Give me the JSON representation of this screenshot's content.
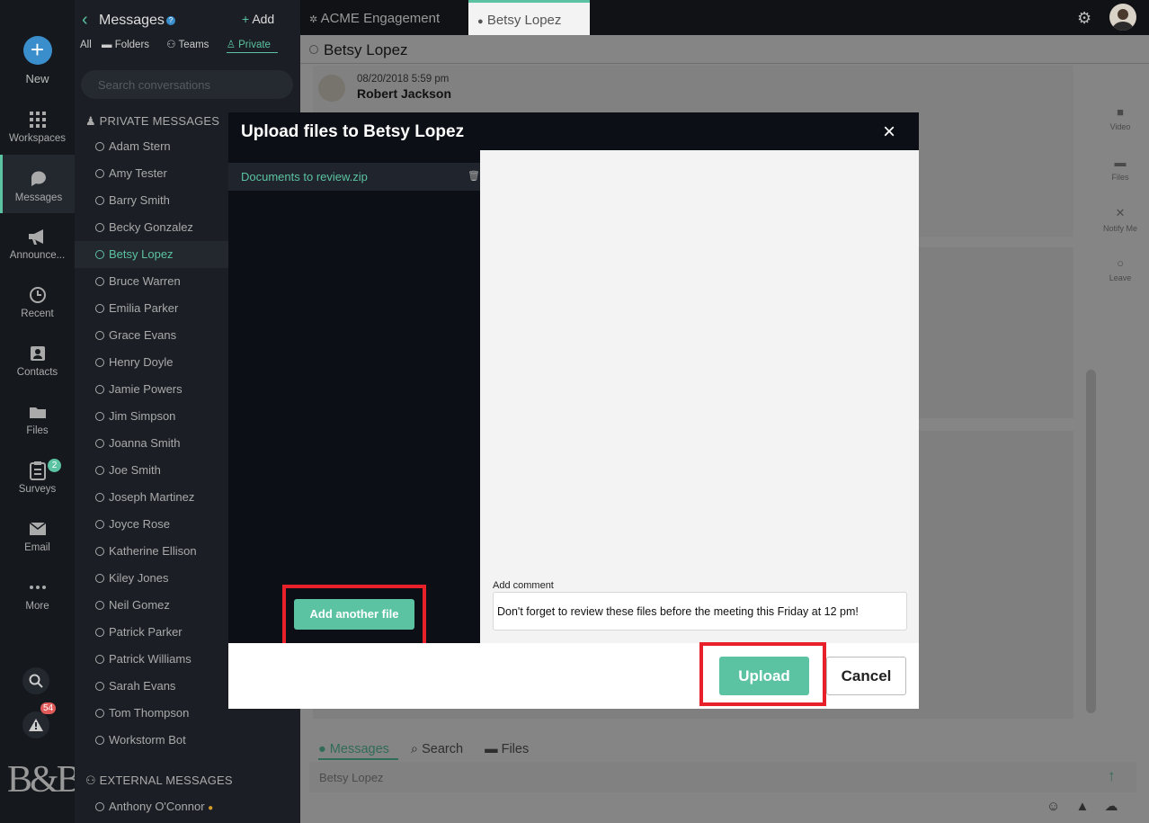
{
  "rail": {
    "new_label": "New",
    "items": [
      {
        "label": "Workspaces",
        "icon": "grid-icon"
      },
      {
        "label": "Messages",
        "icon": "chat-icon"
      },
      {
        "label": "Announce...",
        "icon": "megaphone-icon"
      },
      {
        "label": "Recent",
        "icon": "history-icon"
      },
      {
        "label": "Contacts",
        "icon": "contacts-icon"
      },
      {
        "label": "Files",
        "icon": "folder-icon"
      },
      {
        "label": "Surveys",
        "icon": "survey-icon",
        "badge": "2"
      },
      {
        "label": "Email",
        "icon": "envelope-icon"
      },
      {
        "label": "More",
        "icon": "ellipsis-icon"
      }
    ],
    "alert_badge": "54",
    "logo": "B&B"
  },
  "sidebar": {
    "title": "Messages",
    "help": "?",
    "add_label": "Add",
    "filters": [
      "All",
      "Folders",
      "Teams",
      "Private"
    ],
    "search_placeholder": "Search conversations",
    "private_section": "PRIVATE MESSAGES",
    "contacts": [
      "Adam Stern",
      "Amy Tester",
      "Barry Smith",
      "Becky Gonzalez",
      "Betsy Lopez",
      "Bruce Warren",
      "Emilia Parker",
      "Grace Evans",
      "Henry Doyle",
      "Jamie Powers",
      "Jim Simpson",
      "Joanna Smith",
      "Joe Smith",
      "Joseph Martinez",
      "Joyce Rose",
      "Katherine Ellison",
      "Kiley Jones",
      "Neil Gomez",
      "Patrick Parker",
      "Patrick Williams",
      "Sarah Evans",
      "Tom Thompson",
      "Workstorm Bot"
    ],
    "active_contact": "Betsy Lopez",
    "external_section": "EXTERNAL MESSAGES",
    "external_contacts": [
      "Anthony O'Connor"
    ]
  },
  "topbar": {
    "tabs": [
      {
        "label": "ACME Engagement"
      },
      {
        "label": "Betsy Lopez"
      }
    ]
  },
  "main": {
    "chat_title": "Betsy Lopez",
    "message": {
      "time": "08/20/2018 5:59 pm",
      "author": "Robert Jackson"
    },
    "side_actions": [
      "Video",
      "Files",
      "Notify Me",
      "Leave"
    ],
    "bottom_tabs": [
      "Messages",
      "Search",
      "Files"
    ],
    "composer_placeholder": "Betsy Lopez"
  },
  "modal": {
    "title": "Upload files to Betsy Lopez",
    "close": "×",
    "file_name": "Documents to review.zip",
    "add_file_label": "Add another file",
    "comment_label": "Add comment",
    "comment_value": "Don't forget to review these files before the meeting this Friday at 12 pm!",
    "upload_label": "Upload",
    "cancel_label": "Cancel"
  },
  "colors": {
    "accent": "#5bc3a1",
    "highlight": "#e8202a",
    "dark": "#0c0f15"
  }
}
